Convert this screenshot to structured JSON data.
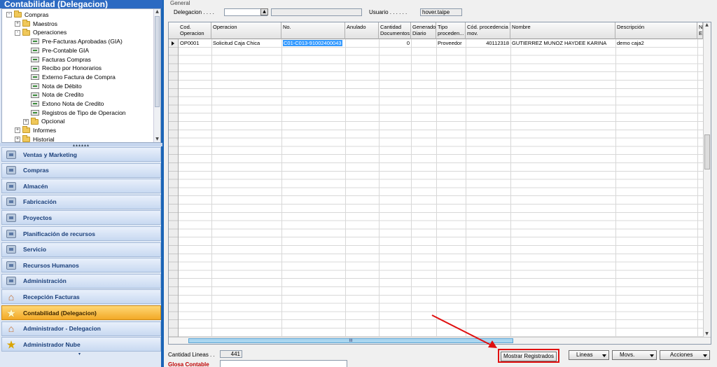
{
  "left_panel": {
    "title": "Contabilidad (Delegacion)",
    "tree": [
      {
        "label": "Compras",
        "level": 0,
        "type": "folder",
        "exp": "-"
      },
      {
        "label": "Maestros",
        "level": 1,
        "type": "folder",
        "exp": "+"
      },
      {
        "label": "Operaciones",
        "level": 1,
        "type": "folder",
        "exp": "-"
      },
      {
        "label": "Pre-Facturas Aprobadas (GIA)",
        "level": 2,
        "type": "doc"
      },
      {
        "label": "Pre-Contable GIA",
        "level": 2,
        "type": "doc"
      },
      {
        "label": "Facturas Compras",
        "level": 2,
        "type": "doc"
      },
      {
        "label": "Recibo por Honorarios",
        "level": 2,
        "type": "doc"
      },
      {
        "label": "Externo Factura de Compra",
        "level": 2,
        "type": "doc"
      },
      {
        "label": "Nota de Débito",
        "level": 2,
        "type": "doc"
      },
      {
        "label": "Nota de Credito",
        "level": 2,
        "type": "doc"
      },
      {
        "label": "Extono Nota de Credito",
        "level": 2,
        "type": "doc"
      },
      {
        "label": "Registros de Tipo de Operacion",
        "level": 2,
        "type": "doc"
      },
      {
        "label": "Opcional",
        "level": 2,
        "type": "folder",
        "exp": "+"
      },
      {
        "label": "Informes",
        "level": 1,
        "type": "folder",
        "exp": "+"
      },
      {
        "label": "Historial",
        "level": 1,
        "type": "folder",
        "exp": "+"
      }
    ],
    "nav_items": [
      {
        "label": "Ventas y Marketing",
        "icon": "sales-icon",
        "active": false
      },
      {
        "label": "Compras",
        "icon": "purchases-icon",
        "active": false
      },
      {
        "label": "Almacén",
        "icon": "warehouse-icon",
        "active": false
      },
      {
        "label": "Fabricación",
        "icon": "manufacturing-icon",
        "active": false
      },
      {
        "label": "Proyectos",
        "icon": "projects-icon",
        "active": false
      },
      {
        "label": "Planificación de recursos",
        "icon": "resource-planning-icon",
        "active": false
      },
      {
        "label": "Servicio",
        "icon": "service-icon",
        "active": false
      },
      {
        "label": "Recursos Humanos",
        "icon": "hr-icon",
        "active": false
      },
      {
        "label": "Administración",
        "icon": "administration-icon",
        "active": false
      },
      {
        "label": "Recepción  Facturas",
        "icon": "house-icon",
        "active": false
      },
      {
        "label": "Contabilidad (Delegacion)",
        "icon": "star-icon",
        "active": true
      },
      {
        "label": "Administrador - Delegacion",
        "icon": "house-icon",
        "active": false
      },
      {
        "label": "Administrador Nube",
        "icon": "star-icon",
        "active": false
      }
    ]
  },
  "header": {
    "group_label": "General",
    "delegacion_label": "Delegacion . . . .",
    "delegacion_value": "",
    "delegacion_desc": "",
    "usuario_label": "Usuario . . . . . .",
    "usuario_value": "hover.taipe"
  },
  "grid": {
    "columns": [
      {
        "label": "Cod.\nOperacion"
      },
      {
        "label": "Operacion"
      },
      {
        "label": "No."
      },
      {
        "label": "Anulado"
      },
      {
        "label": "Cantidad\nDocumentos"
      },
      {
        "label": "Generado\nDiario"
      },
      {
        "label": "Tipo\nproceden..."
      },
      {
        "label": "Cód. procedencia\nmov."
      },
      {
        "label": "Nombre"
      },
      {
        "label": "Descripción"
      },
      {
        "label": "N\nE"
      }
    ],
    "rows": [
      {
        "cod_operacion": "OP0001",
        "operacion": "Solicitud Caja Chica",
        "no": "C01-C013-91002400043",
        "anulado": "",
        "cantidad_documentos": "0",
        "generado_diario": "",
        "tipo_procedencia": "Proveedor",
        "cod_procedencia": "40112318",
        "nombre": "GUTIERREZ MUNOZ HAYDEE KARINA",
        "descripcion": "demo caja2",
        "ne": ""
      }
    ],
    "hscroll_grip": "III"
  },
  "footer": {
    "cantidad_lineas_label": "Cantidad Lineas . .",
    "cantidad_lineas_value": "441",
    "glosa_label": "Glosa Contable",
    "glosa_value": "",
    "buttons": {
      "mostrar": "Mostrar Registrados",
      "lineas": "Lineas",
      "movs": "Movs.",
      "acciones": "Acciones"
    }
  },
  "colors": {
    "accent": "#1a64b7",
    "active_nav": "#f2a927",
    "highlight": "#e01010",
    "selection": "#3399ff"
  }
}
